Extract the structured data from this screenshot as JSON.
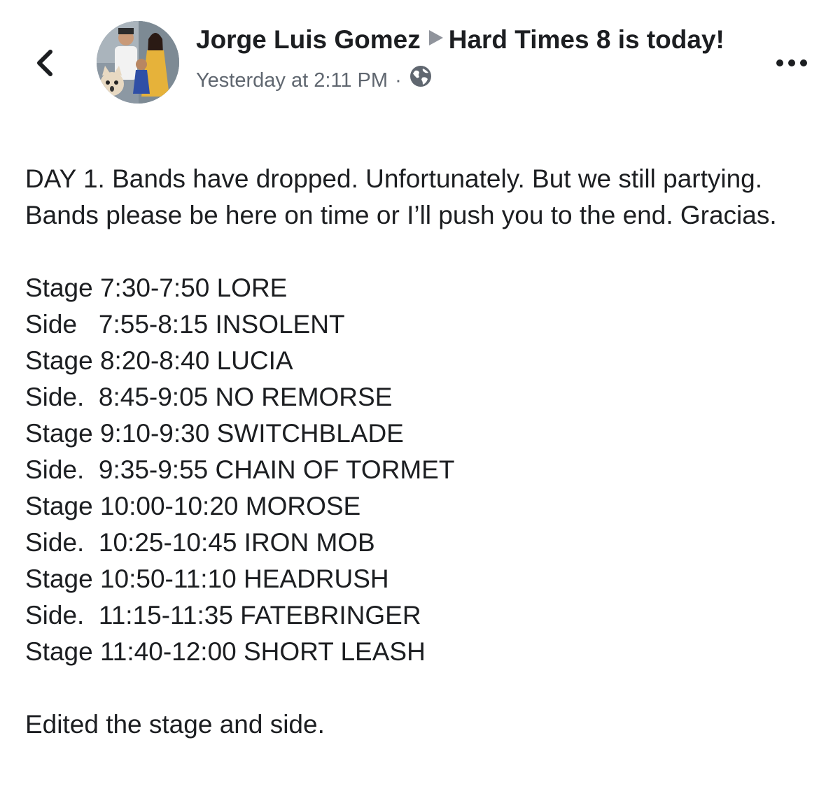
{
  "header": {
    "author": "Jorge Luis Gomez",
    "event_title": "Hard Times 8 is today!",
    "timestamp": "Yesterday at 2:11 PM",
    "separator": "·",
    "audience_icon": "globe-icon",
    "back_icon": "chevron-left-icon",
    "more_icon": "more-horizontal-icon"
  },
  "post": {
    "intro": "DAY 1. Bands have dropped. Unfortunately. But we still partying. Bands please be here on time or I’ll push you to the end. Gracias.",
    "schedule": [
      "Stage 7:30-7:50 LORE",
      "Side   7:55-8:15 INSOLENT",
      "Stage 8:20-8:40 LUCIA",
      "Side.  8:45-9:05 NO REMORSE",
      "Stage 9:10-9:30 SWITCHBLADE",
      "Side.  9:35-9:55 CHAIN OF TORMET",
      "Stage 10:00-10:20 MOROSE",
      "Side.  10:25-10:45 IRON MOB",
      "Stage 10:50-11:10 HEADRUSH",
      "Side.  11:15-11:35 FATEBRINGER",
      "Stage 11:40-12:00 SHORT LEASH"
    ],
    "outro": "Edited the stage and side."
  },
  "colors": {
    "text": "#1c1e21",
    "meta": "#606770",
    "arrow": "#90949c"
  }
}
